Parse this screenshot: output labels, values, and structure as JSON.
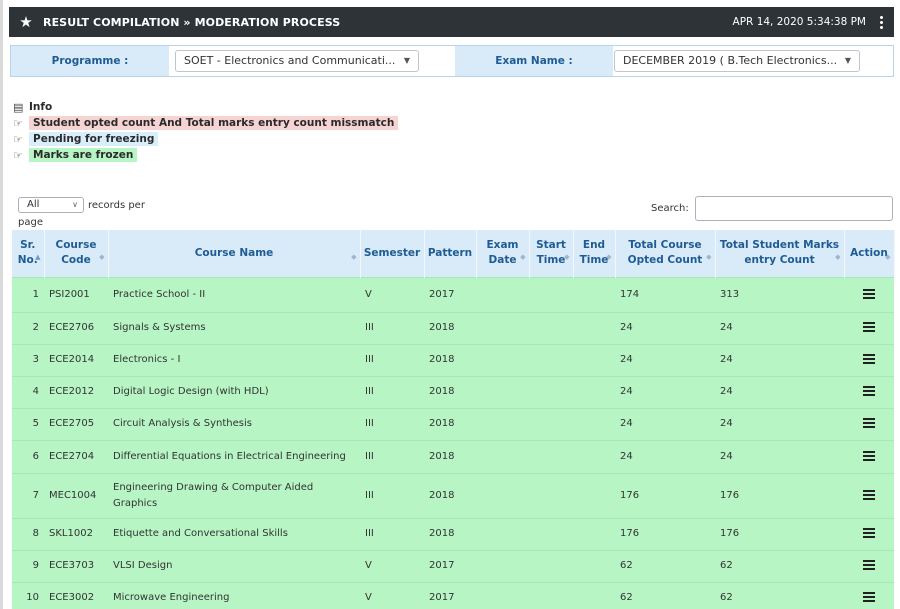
{
  "header": {
    "title": "RESULT COMPILATION » MODERATION PROCESS",
    "datetime": "APR 14, 2020  5:34:38 PM"
  },
  "filters": {
    "programme_label": "Programme :",
    "programme_value": "SOET - Electronics and Communicati...",
    "exam_label": "Exam Name :",
    "exam_value": "DECEMBER 2019 ( B.Tech Electronics..."
  },
  "info": {
    "title": "Info",
    "legend": [
      {
        "text": "Student opted count And Total marks entry count missmatch",
        "color": "#f7d4d4"
      },
      {
        "text": "Pending for freezing",
        "color": "#d9eefb"
      },
      {
        "text": "Marks are frozen",
        "color": "#b7f5c4"
      }
    ]
  },
  "table_controls": {
    "length_value": "All",
    "records_per": "records per",
    "page_word": "page",
    "search_label": "Search:"
  },
  "table": {
    "columns": [
      "Sr.\nNo.",
      "Course\nCode",
      "Course Name",
      "Semester",
      "Pattern",
      "Exam\nDate",
      "Start\nTime",
      "End\nTime",
      "Total Course\nOpted Count",
      "Total Student Marks\nentry Count",
      "Action"
    ],
    "rows": [
      {
        "sr": "1",
        "code": "PSI2001",
        "name": "Practice School - II",
        "semester": "V",
        "pattern": "2017",
        "exam_date": "",
        "start": "",
        "end": "",
        "opted": "174",
        "entry": "313"
      },
      {
        "sr": "2",
        "code": "ECE2706",
        "name": "Signals & Systems",
        "semester": "III",
        "pattern": "2018",
        "exam_date": "",
        "start": "",
        "end": "",
        "opted": "24",
        "entry": "24"
      },
      {
        "sr": "3",
        "code": "ECE2014",
        "name": "Electronics - I",
        "semester": "III",
        "pattern": "2018",
        "exam_date": "",
        "start": "",
        "end": "",
        "opted": "24",
        "entry": "24"
      },
      {
        "sr": "4",
        "code": "ECE2012",
        "name": "Digital Logic Design (with HDL)",
        "semester": "III",
        "pattern": "2018",
        "exam_date": "",
        "start": "",
        "end": "",
        "opted": "24",
        "entry": "24"
      },
      {
        "sr": "5",
        "code": "ECE2705",
        "name": "Circuit Analysis & Synthesis",
        "semester": "III",
        "pattern": "2018",
        "exam_date": "",
        "start": "",
        "end": "",
        "opted": "24",
        "entry": "24"
      },
      {
        "sr": "6",
        "code": "ECE2704",
        "name": "Differential Equations in Electrical Engineering",
        "semester": "III",
        "pattern": "2018",
        "exam_date": "",
        "start": "",
        "end": "",
        "opted": "24",
        "entry": "24"
      },
      {
        "sr": "7",
        "code": "MEC1004",
        "name": "Engineering Drawing & Computer Aided Graphics",
        "semester": "III",
        "pattern": "2018",
        "exam_date": "",
        "start": "",
        "end": "",
        "opted": "176",
        "entry": "176"
      },
      {
        "sr": "8",
        "code": "SKL1002",
        "name": "Etiquette and Conversational Skills",
        "semester": "III",
        "pattern": "2018",
        "exam_date": "",
        "start": "",
        "end": "",
        "opted": "176",
        "entry": "176"
      },
      {
        "sr": "9",
        "code": "ECE3703",
        "name": "VLSI Design",
        "semester": "V",
        "pattern": "2017",
        "exam_date": "",
        "start": "",
        "end": "",
        "opted": "62",
        "entry": "62"
      },
      {
        "sr": "10",
        "code": "ECE3002",
        "name": "Microwave Engineering",
        "semester": "V",
        "pattern": "2017",
        "exam_date": "",
        "start": "",
        "end": "",
        "opted": "62",
        "entry": "62"
      }
    ]
  }
}
